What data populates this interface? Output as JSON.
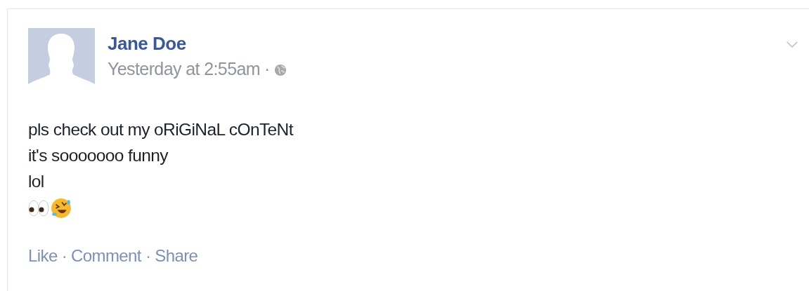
{
  "post": {
    "author": "Jane Doe",
    "timestamp": "Yesterday at 2:55am",
    "separator": "·",
    "lines": [
      "pls check out my oRiGiNaL cOnTeNt",
      "it's sooooooo funny",
      "lol"
    ],
    "emoji": [
      {
        "kind": "eyes"
      },
      {
        "kind": "laughing"
      }
    ],
    "actions": [
      {
        "label": "Like"
      },
      {
        "label": "Comment"
      },
      {
        "label": "Share"
      }
    ]
  }
}
